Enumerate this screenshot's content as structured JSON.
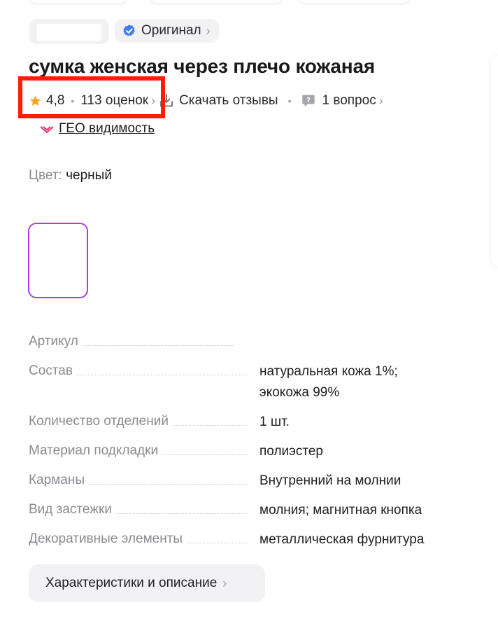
{
  "product": {
    "original_badge": "Оригинал",
    "title": "сумка женская через плечо кожаная",
    "rating": "4,8",
    "ratings_count": "113 оценок",
    "download_reviews": "Скачать отзывы",
    "questions": "1 вопрос",
    "geo_link": "ГЕО видимость",
    "color_label": "Цвет:",
    "color_value": "черный"
  },
  "specs": [
    {
      "label": "Артикул",
      "value": [
        "",
        ""
      ]
    },
    {
      "label": "Состав",
      "value": [
        "натуральная кожа 1%;",
        "экокожа 99%"
      ]
    },
    {
      "label": "Количество отделений",
      "value": [
        "1 шт.",
        ""
      ]
    },
    {
      "label": "Материал подкладки",
      "value": [
        "полиэстер",
        ""
      ]
    },
    {
      "label": "Карманы",
      "value": [
        "Внутренний на молнии",
        ""
      ]
    },
    {
      "label": "Вид застежки",
      "value": [
        "молния; магнитная кнопка",
        ""
      ]
    },
    {
      "label": "Декоративные элементы",
      "value": [
        "металлическая фурнитура",
        ""
      ]
    }
  ],
  "description_button": "Характеристики и описание",
  "icons": {
    "verified": "verified-check-icon",
    "star": "star-icon",
    "download": "download-icon",
    "question": "question-bubble-icon",
    "geo": "geo-visibility-icon",
    "chevron": "chevron-right-icon"
  },
  "colors": {
    "star": "#f5a524",
    "verified": "#3f7cf0",
    "highlight": "#ff1f00",
    "swatch_border": "#a93de8",
    "geo_icon": "#e8336d"
  }
}
